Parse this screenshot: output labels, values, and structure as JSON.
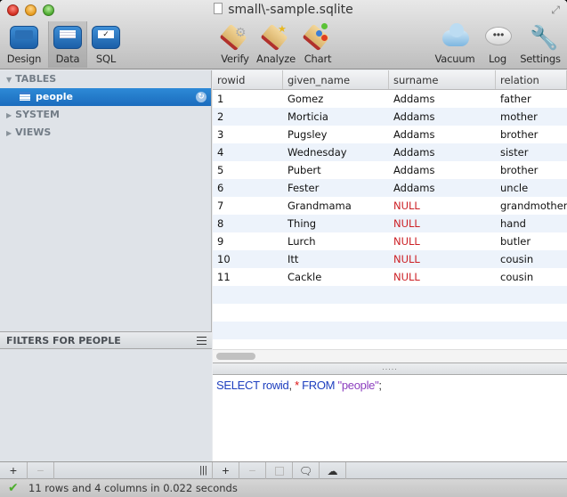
{
  "window": {
    "title": "small\\-sample.sqlite"
  },
  "toolbar": {
    "mode_buttons": [
      {
        "label": "Design",
        "icon": "design-tray-icon"
      },
      {
        "label": "Data",
        "icon": "data-tray-icon",
        "selected": true
      },
      {
        "label": "SQL",
        "icon": "sql-tray-icon"
      }
    ],
    "tools": [
      {
        "label": "Verify",
        "icon": "verify-tag-gear-icon"
      },
      {
        "label": "Analyze",
        "icon": "analyze-tag-wand-icon"
      },
      {
        "label": "Chart",
        "icon": "chart-tag-dots-icon"
      }
    ],
    "right_tools": [
      {
        "label": "Vacuum",
        "icon": "cloud-icon"
      },
      {
        "label": "Log",
        "icon": "speech-bubble-icon",
        "glyph": "•••"
      },
      {
        "label": "Settings",
        "icon": "wrench-icon"
      }
    ]
  },
  "sidebar": {
    "sections": [
      {
        "label": "TABLES",
        "expanded": true
      },
      {
        "label": "SYSTEM",
        "expanded": false
      },
      {
        "label": "VIEWS",
        "expanded": false
      }
    ],
    "tables": [
      {
        "label": "people",
        "selected": true
      }
    ],
    "filters_header": "FILTERS FOR PEOPLE"
  },
  "grid": {
    "columns": [
      "rowid",
      "given_name",
      "surname",
      "relation"
    ],
    "rows": [
      [
        "1",
        "Gomez",
        "Addams",
        "father"
      ],
      [
        "2",
        "Morticia",
        "Addams",
        "mother"
      ],
      [
        "3",
        "Pugsley",
        "Addams",
        "brother"
      ],
      [
        "4",
        "Wednesday",
        "Addams",
        "sister"
      ],
      [
        "5",
        "Pubert",
        "Addams",
        "brother"
      ],
      [
        "6",
        "Fester",
        "Addams",
        "uncle"
      ],
      [
        "7",
        "Grandmama",
        "NULL",
        "grandmother"
      ],
      [
        "8",
        "Thing",
        "NULL",
        "hand"
      ],
      [
        "9",
        "Lurch",
        "NULL",
        "butler"
      ],
      [
        "10",
        "Itt",
        "NULL",
        "cousin"
      ],
      [
        "11",
        "Cackle",
        "NULL",
        "cousin"
      ]
    ],
    "null_color": "#cc1f24"
  },
  "sql": {
    "keyword_select": "SELECT",
    "column": "rowid",
    "comma": ",",
    "star": "*",
    "keyword_from": "FROM",
    "table_literal": "\"people\"",
    "terminator": ";"
  },
  "bottom_bar": {
    "add": "+",
    "remove": "−",
    "columns": "|||"
  },
  "status": {
    "text": "11 rows and 4 columns in 0.022 seconds",
    "icon": "checkmark-icon"
  }
}
